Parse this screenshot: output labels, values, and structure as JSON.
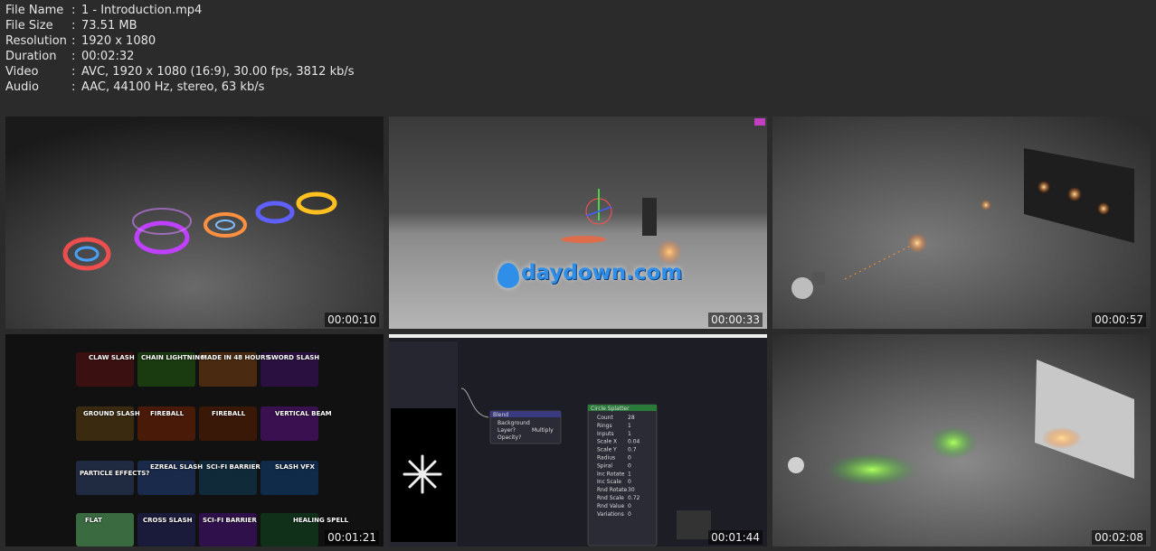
{
  "file_info": [
    {
      "label": "File Name",
      "value": "1 - Introduction.mp4"
    },
    {
      "label": "File Size",
      "value": "73.51 MB"
    },
    {
      "label": "Resolution",
      "value": "1920 x 1080"
    },
    {
      "label": "Duration",
      "value": "00:02:32"
    },
    {
      "label": "Video",
      "value": "AVC, 1920 x 1080 (16:9), 30.00 fps, 3812 kb/s"
    },
    {
      "label": "Audio",
      "value": "AAC, 44100 Hz, stereo, 63 kb/s"
    }
  ],
  "separator": ":",
  "thumbnails": [
    {
      "timestamp": "00:00:10"
    },
    {
      "timestamp": "00:00:33",
      "watermark": "daydown.com"
    },
    {
      "timestamp": "00:00:57"
    },
    {
      "timestamp": "00:01:21",
      "cards": [
        "CLAW SLASH",
        "CHAIN LIGHTNING",
        "MADE IN 48 HOURS",
        "SWORD SLASH",
        "GROUND SLASH",
        "FIREBALL",
        "FIREBALL",
        "VERTICAL BEAM",
        "PARTICLE EFFECTS?",
        "EZREAL SLASH",
        "SCI-FI BARRIER",
        "SLASH VFX",
        "FLAT",
        "CROSS SLASH",
        "SCI-FI BARRIER",
        "HEALING SPELL"
      ]
    },
    {
      "timestamp": "00:01:44",
      "nodes": {
        "blend": {
          "title": "Blend",
          "rows": [
            "Background",
            "Layer?",
            "Opacity?"
          ],
          "mode": "Multiply"
        },
        "circle": {
          "title": "Circle Splatter",
          "rows": [
            "Count",
            "Rings",
            "Inputs",
            "Scale X",
            "Scale Y",
            "Radius",
            "Spiral",
            "Inc Rotate",
            "Inc Scale",
            "Rnd Rotate",
            "Rnd Scale",
            "Rnd Value",
            "Variations"
          ],
          "values": [
            "28",
            "1",
            "1",
            "0.04",
            "0.7",
            "0",
            "0",
            "1",
            "0",
            "30",
            "0.72",
            "0",
            "0"
          ]
        }
      }
    },
    {
      "timestamp": "00:02:08"
    }
  ]
}
